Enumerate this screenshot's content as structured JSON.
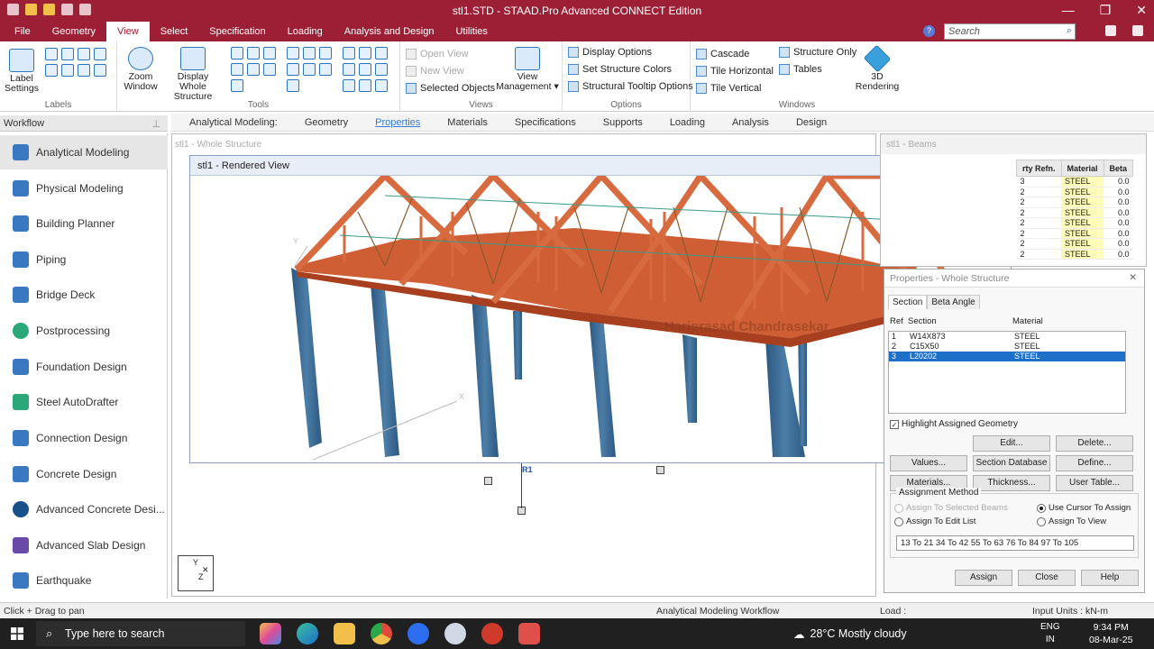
{
  "window": {
    "title": "stl1.STD - STAAD.Pro Advanced CONNECT Edition",
    "min": "—",
    "max": "❐",
    "close": "✕"
  },
  "menu": {
    "items": [
      "File",
      "Geometry",
      "View",
      "Select",
      "Specification",
      "Loading",
      "Analysis and Design",
      "Utilities"
    ],
    "active": "View"
  },
  "search": {
    "placeholder": "Search"
  },
  "ribbon": {
    "label_settings": "Label\nSettings",
    "zoom_window": "Zoom\nWindow",
    "display_whole": "Display\nWhole Structure",
    "open_view": "Open View",
    "new_view": "New View",
    "selected_objects": "Selected Objects",
    "view_management": "View\nManagement ▾",
    "display_options": "Display Options",
    "set_structure_colors": "Set Structure Colors",
    "structural_tooltip": "Structural Tooltip Options",
    "cascade": "Cascade",
    "tile_horizontal": "Tile Horizontal",
    "tile_vertical": "Tile Vertical",
    "structure_only": "Structure Only",
    "tables": "Tables",
    "rendering": "3D\nRendering",
    "groups": {
      "labels": "Labels",
      "tools": "Tools",
      "views": "Views",
      "options": "Options",
      "windows": "Windows"
    }
  },
  "workflow": {
    "header": "Workflow",
    "items": [
      "Analytical Modeling",
      "Physical Modeling",
      "Building Planner",
      "Piping",
      "Bridge Deck",
      "Postprocessing",
      "Foundation Design",
      "Steel AutoDrafter",
      "Connection Design",
      "Concrete Design",
      "Advanced Concrete Desi...",
      "Advanced Slab Design",
      "Earthquake"
    ]
  },
  "subtabs": {
    "heading": "Analytical Modeling:",
    "items": [
      "Geometry",
      "Properties",
      "Materials",
      "Specifications",
      "Supports",
      "Loading",
      "Analysis",
      "Design"
    ],
    "active": "Properties"
  },
  "whole_structure": {
    "title": "stl1 - Whole Structure"
  },
  "rendered_view": {
    "title": "stl1 - Rendered View",
    "watermark": "Hariprasad Chandrasekar",
    "axis_y": "Y",
    "axis_x": "X"
  },
  "beams": {
    "title": "stl1 - Beams",
    "headers": [
      "rty Refn.",
      "Material",
      "Beta"
    ],
    "rows": [
      [
        "3",
        "STEEL",
        "0.0"
      ],
      [
        "2",
        "STEEL",
        "0.0"
      ],
      [
        "2",
        "STEEL",
        "0.0"
      ],
      [
        "2",
        "STEEL",
        "0.0"
      ],
      [
        "2",
        "STEEL",
        "0.0"
      ],
      [
        "2",
        "STEEL",
        "0.0"
      ],
      [
        "2",
        "STEEL",
        "0.0"
      ],
      [
        "2",
        "STEEL",
        "0.0"
      ]
    ]
  },
  "support_label": "R1",
  "axes_mini": {
    "y": "Y",
    "z": "Z"
  },
  "properties": {
    "title": "Properties - Whole Structure",
    "tabs": [
      "Section",
      "Beta Angle"
    ],
    "headers": [
      "Ref",
      "Section",
      "Material"
    ],
    "rows": [
      [
        "1",
        "W14X873",
        "STEEL"
      ],
      [
        "2",
        "C15X50",
        "STEEL"
      ],
      [
        "3",
        "L20202",
        "STEEL"
      ]
    ],
    "highlight_label": "Highlight Assigned Geometry",
    "buttons": {
      "edit": "Edit...",
      "delete": "Delete...",
      "values": "Values...",
      "section_db": "Section Database",
      "define": "Define...",
      "materials": "Materials...",
      "thickness": "Thickness...",
      "user_table": "User Table...",
      "assign": "Assign",
      "close": "Close",
      "help": "Help"
    },
    "assignment_method": "Assignment Method",
    "radios": {
      "selected_beams": "Assign To Selected Beams",
      "use_cursor": "Use Cursor To Assign",
      "edit_list": "Assign To Edit List",
      "view": "Assign To View"
    },
    "edit_list_value": "13 To 21 34 To 42 55 To 63 76 To 84 97 To 105"
  },
  "status": {
    "hint": "Click + Drag to pan",
    "workflow": "Analytical Modeling Workflow",
    "load": "Load :",
    "units": "Input Units : kN-m"
  },
  "taskbar": {
    "search": "Type here to search",
    "weather": "28°C  Mostly cloudy",
    "lang1": "ENG",
    "lang2": "IN",
    "time": "9:34 PM",
    "date": "08-Mar-25"
  },
  "colors": {
    "brand": "#9c1f36",
    "member": "#d2663c",
    "column": "#3a6d94",
    "select": "#1e6fc8"
  }
}
